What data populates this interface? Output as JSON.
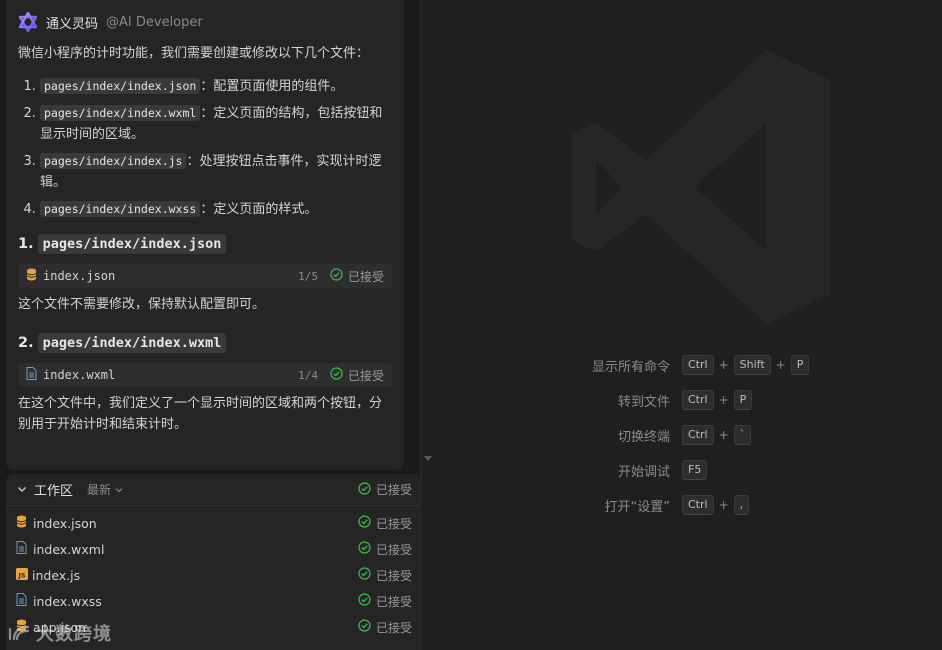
{
  "assistant": {
    "name": "通义灵码",
    "mention": "@AI Developer"
  },
  "intro": "微信小程序的计时功能，我们需要创建或修改以下几个文件：",
  "file_items": [
    {
      "path": "pages/index/index.json",
      "desc": "：配置页面使用的组件。"
    },
    {
      "path": "pages/index/index.wxml",
      "desc": "：定义页面的结构，包括按钮和显示时间的区域。"
    },
    {
      "path": "pages/index/index.js",
      "desc": "：处理按钮点击事件，实现计时逻辑。"
    },
    {
      "path": "pages/index/index.wxss",
      "desc": "：定义页面的样式。"
    }
  ],
  "sections": [
    {
      "number": "1.",
      "heading": "pages/index/index.json",
      "chip": {
        "name": "index.json",
        "count": "1/5",
        "status": "已接受"
      },
      "text": "这个文件不需要修改，保持默认配置即可。"
    },
    {
      "number": "2.",
      "heading": "pages/index/index.wxml",
      "chip": {
        "name": "index.wxml",
        "count": "1/4",
        "status": "已接受"
      },
      "text": "在这个文件中，我们定义了一个显示时间的区域和两个按钮，分别用于开始计时和结束计时。"
    }
  ],
  "workspace": {
    "title": "工作区",
    "filter": "最新",
    "status": "已接受",
    "files": [
      {
        "name": "index.json",
        "icon": "json-file-icon",
        "status": "已接受"
      },
      {
        "name": "index.wxml",
        "icon": "document-file-icon",
        "status": "已接受"
      },
      {
        "name": "index.js",
        "icon": "js-file-icon",
        "status": "已接受"
      },
      {
        "name": "index.wxss",
        "icon": "document-file-icon",
        "status": "已接受"
      },
      {
        "name": "app.json",
        "icon": "json-file-icon",
        "status": "已接受"
      }
    ]
  },
  "watermark": "大数跨境",
  "shortcuts": [
    {
      "label": "显示所有命令",
      "keys": [
        "Ctrl",
        "Shift",
        "P"
      ]
    },
    {
      "label": "转到文件",
      "keys": [
        "Ctrl",
        "P"
      ]
    },
    {
      "label": "切换终端",
      "keys": [
        "Ctrl",
        "`"
      ]
    },
    {
      "label": "开始调试",
      "keys": [
        "F5"
      ]
    },
    {
      "label": "打开“设置”",
      "keys": [
        "Ctrl",
        ","
      ]
    }
  ],
  "colors": {
    "accepted": "#3fb950",
    "json_icon": "#e8a33d",
    "js_icon": "#e8a33d",
    "doc_icon": "#6d9bc3",
    "logo": "#8b6cff"
  }
}
